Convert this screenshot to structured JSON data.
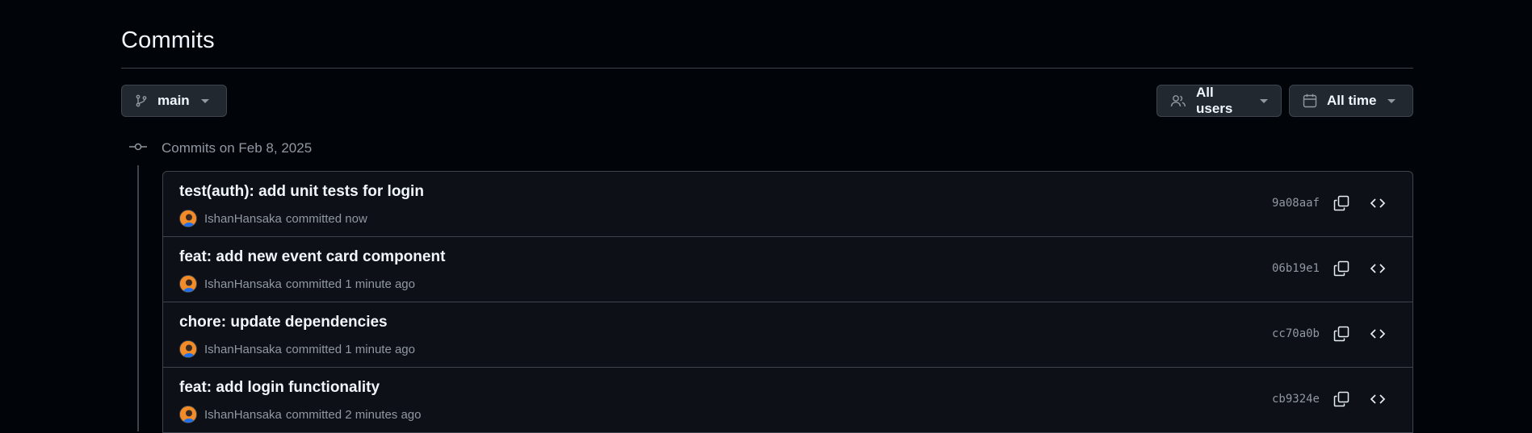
{
  "header": {
    "title": "Commits"
  },
  "filters": {
    "branch_label": "main",
    "users_label": "All users",
    "time_label": "All time"
  },
  "group": {
    "label": "Commits on Feb 8, 2025"
  },
  "commits": [
    {
      "title": "test(auth): add unit tests for login",
      "author": "IshanHansaka",
      "time": "committed now",
      "sha": "9a08aaf"
    },
    {
      "title": "feat: add new event card component",
      "author": "IshanHansaka",
      "time": "committed 1 minute ago",
      "sha": "06b19e1"
    },
    {
      "title": "chore: update dependencies",
      "author": "IshanHansaka",
      "time": "committed 1 minute ago",
      "sha": "cc70a0b"
    },
    {
      "title": "feat: add login functionality",
      "author": "IshanHansaka",
      "time": "committed 2 minutes ago",
      "sha": "cb9324e"
    }
  ],
  "icons": {
    "branch": "git-branch-icon",
    "users": "people-icon",
    "time": "calendar-icon",
    "group": "git-commit-icon",
    "copy": "copy-icon",
    "code": "code-icon"
  },
  "colors": {
    "background": "#010409",
    "border": "#3d444d",
    "muted_text": "#9198a1"
  }
}
